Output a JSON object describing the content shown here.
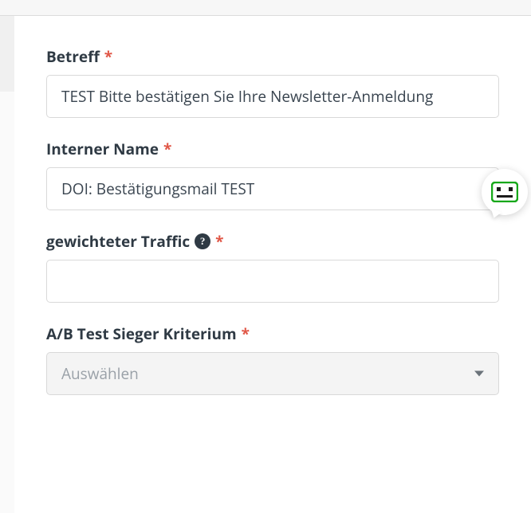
{
  "fields": {
    "betreff": {
      "label": "Betreff",
      "required_mark": "*",
      "value": "TEST Bitte bestätigen Sie Ihre Newsletter-Anmeldung"
    },
    "interner_name": {
      "label": "Interner Name",
      "required_mark": "*",
      "value": "DOI: Bestätigungsmail TEST"
    },
    "gewichteter_traffic": {
      "label": "gewichteter Traffic",
      "required_mark": "*",
      "help_glyph": "?",
      "value": ""
    },
    "ab_test_sieger": {
      "label": "A/B Test Sieger Kriterium",
      "required_mark": "*",
      "placeholder": "Auswählen"
    }
  }
}
